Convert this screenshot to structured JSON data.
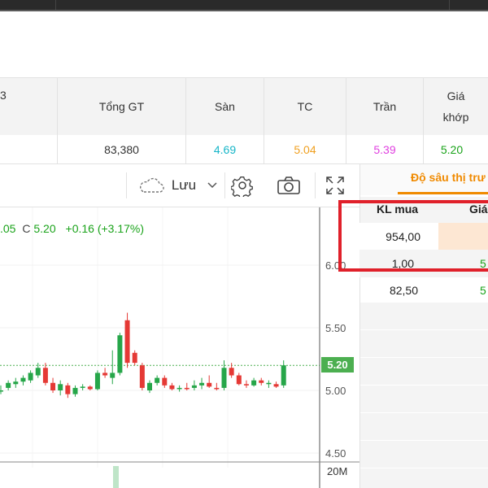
{
  "quote_table": {
    "headers": [
      {
        "key": "col_partial",
        "label": "3"
      },
      {
        "key": "total_value",
        "label": "Tổng GT"
      },
      {
        "key": "floor",
        "label": "Sàn"
      },
      {
        "key": "reference",
        "label": "TC"
      },
      {
        "key": "ceiling",
        "label": "Trần"
      },
      {
        "key": "matched_price",
        "label": "Giá\nkhớp"
      }
    ],
    "row": {
      "total_value": "83,380",
      "floor": "4.69",
      "reference": "5.04",
      "ceiling": "5.39",
      "matched_price": "5.20"
    },
    "colors": {
      "floor": "#17b6c8",
      "reference": "#f0a020",
      "ceiling": "#e040e0",
      "matched_price": "#1aa31a"
    }
  },
  "toolbar": {
    "save_label": "Lưu",
    "icons": [
      "cloud-icon",
      "chevron-down-icon",
      "gear-icon",
      "camera-icon",
      "fullscreen-icon"
    ]
  },
  "chart": {
    "ohlc_prefix": ".05",
    "close_label": "C",
    "close_value": "5.20",
    "change_text": "+0.16 (+3.17%)",
    "last_price_tag": "5.20",
    "volume_label": "20M",
    "up_color": "#26a649",
    "down_color": "#e53935"
  },
  "chart_data": {
    "type": "candlestick",
    "y_ticks": [
      "6.00",
      "5.50",
      "5.00",
      "4.50"
    ],
    "last_price": 5.2,
    "candles": [
      {
        "o": 5.0,
        "h": 5.04,
        "l": 4.97,
        "c": 5.0
      },
      {
        "o": 5.02,
        "h": 5.08,
        "l": 5.0,
        "c": 5.06
      },
      {
        "o": 5.05,
        "h": 5.1,
        "l": 5.02,
        "c": 5.07
      },
      {
        "o": 5.07,
        "h": 5.12,
        "l": 5.04,
        "c": 5.1
      },
      {
        "o": 5.08,
        "h": 5.16,
        "l": 5.06,
        "c": 5.14
      },
      {
        "o": 5.12,
        "h": 5.22,
        "l": 5.1,
        "c": 5.18
      },
      {
        "o": 5.18,
        "h": 5.22,
        "l": 5.04,
        "c": 5.06
      },
      {
        "o": 5.06,
        "h": 5.1,
        "l": 4.98,
        "c": 5.0
      },
      {
        "o": 5.0,
        "h": 5.08,
        "l": 4.96,
        "c": 5.05
      },
      {
        "o": 5.04,
        "h": 5.06,
        "l": 4.94,
        "c": 4.97
      },
      {
        "o": 4.97,
        "h": 5.04,
        "l": 4.95,
        "c": 5.02
      },
      {
        "o": 5.02,
        "h": 5.05,
        "l": 5.0,
        "c": 5.03
      },
      {
        "o": 5.03,
        "h": 5.04,
        "l": 5.0,
        "c": 5.01
      },
      {
        "o": 5.01,
        "h": 5.16,
        "l": 5.0,
        "c": 5.14
      },
      {
        "o": 5.14,
        "h": 5.18,
        "l": 5.1,
        "c": 5.12
      },
      {
        "o": 5.1,
        "h": 5.32,
        "l": 5.05,
        "c": 5.14
      },
      {
        "o": 5.14,
        "h": 5.46,
        "l": 5.12,
        "c": 5.44
      },
      {
        "o": 5.56,
        "h": 5.62,
        "l": 5.18,
        "c": 5.22
      },
      {
        "o": 5.3,
        "h": 5.32,
        "l": 5.2,
        "c": 5.22
      },
      {
        "o": 5.2,
        "h": 5.22,
        "l": 5.0,
        "c": 5.02
      },
      {
        "o": 5.0,
        "h": 5.08,
        "l": 4.98,
        "c": 5.06
      },
      {
        "o": 5.06,
        "h": 5.12,
        "l": 5.04,
        "c": 5.1
      },
      {
        "o": 5.1,
        "h": 5.12,
        "l": 5.02,
        "c": 5.04
      },
      {
        "o": 5.04,
        "h": 5.06,
        "l": 5.0,
        "c": 5.01
      },
      {
        "o": 5.01,
        "h": 5.04,
        "l": 4.99,
        "c": 5.02
      },
      {
        "o": 5.02,
        "h": 5.06,
        "l": 5.0,
        "c": 5.01
      },
      {
        "o": 5.02,
        "h": 5.08,
        "l": 5.0,
        "c": 5.04
      },
      {
        "o": 5.04,
        "h": 5.1,
        "l": 5.01,
        "c": 5.06
      },
      {
        "o": 5.06,
        "h": 5.12,
        "l": 5.02,
        "c": 5.03
      },
      {
        "o": 5.02,
        "h": 5.06,
        "l": 5.0,
        "c": 5.01
      },
      {
        "o": 5.02,
        "h": 5.24,
        "l": 5.0,
        "c": 5.18
      },
      {
        "o": 5.18,
        "h": 5.22,
        "l": 5.1,
        "c": 5.12
      },
      {
        "o": 5.12,
        "h": 5.14,
        "l": 5.04,
        "c": 5.05
      },
      {
        "o": 5.05,
        "h": 5.08,
        "l": 5.02,
        "c": 5.04
      },
      {
        "o": 5.04,
        "h": 5.1,
        "l": 5.03,
        "c": 5.08
      },
      {
        "o": 5.08,
        "h": 5.1,
        "l": 5.04,
        "c": 5.06
      },
      {
        "o": 5.05,
        "h": 5.08,
        "l": 5.02,
        "c": 5.06
      },
      {
        "o": 5.05,
        "h": 5.07,
        "l": 5.02,
        "c": 5.03
      },
      {
        "o": 5.04,
        "h": 5.24,
        "l": 5.02,
        "c": 5.2
      }
    ]
  },
  "order_book": {
    "tab_label": "Độ sâu thị trư",
    "col_buy_volume": "KL mua",
    "col_price": "Giá",
    "rows": [
      {
        "buy_volume": "954,00",
        "price": ""
      },
      {
        "buy_volume": "1,00",
        "price": "5"
      },
      {
        "buy_volume": "82,50",
        "price": "5"
      }
    ]
  }
}
